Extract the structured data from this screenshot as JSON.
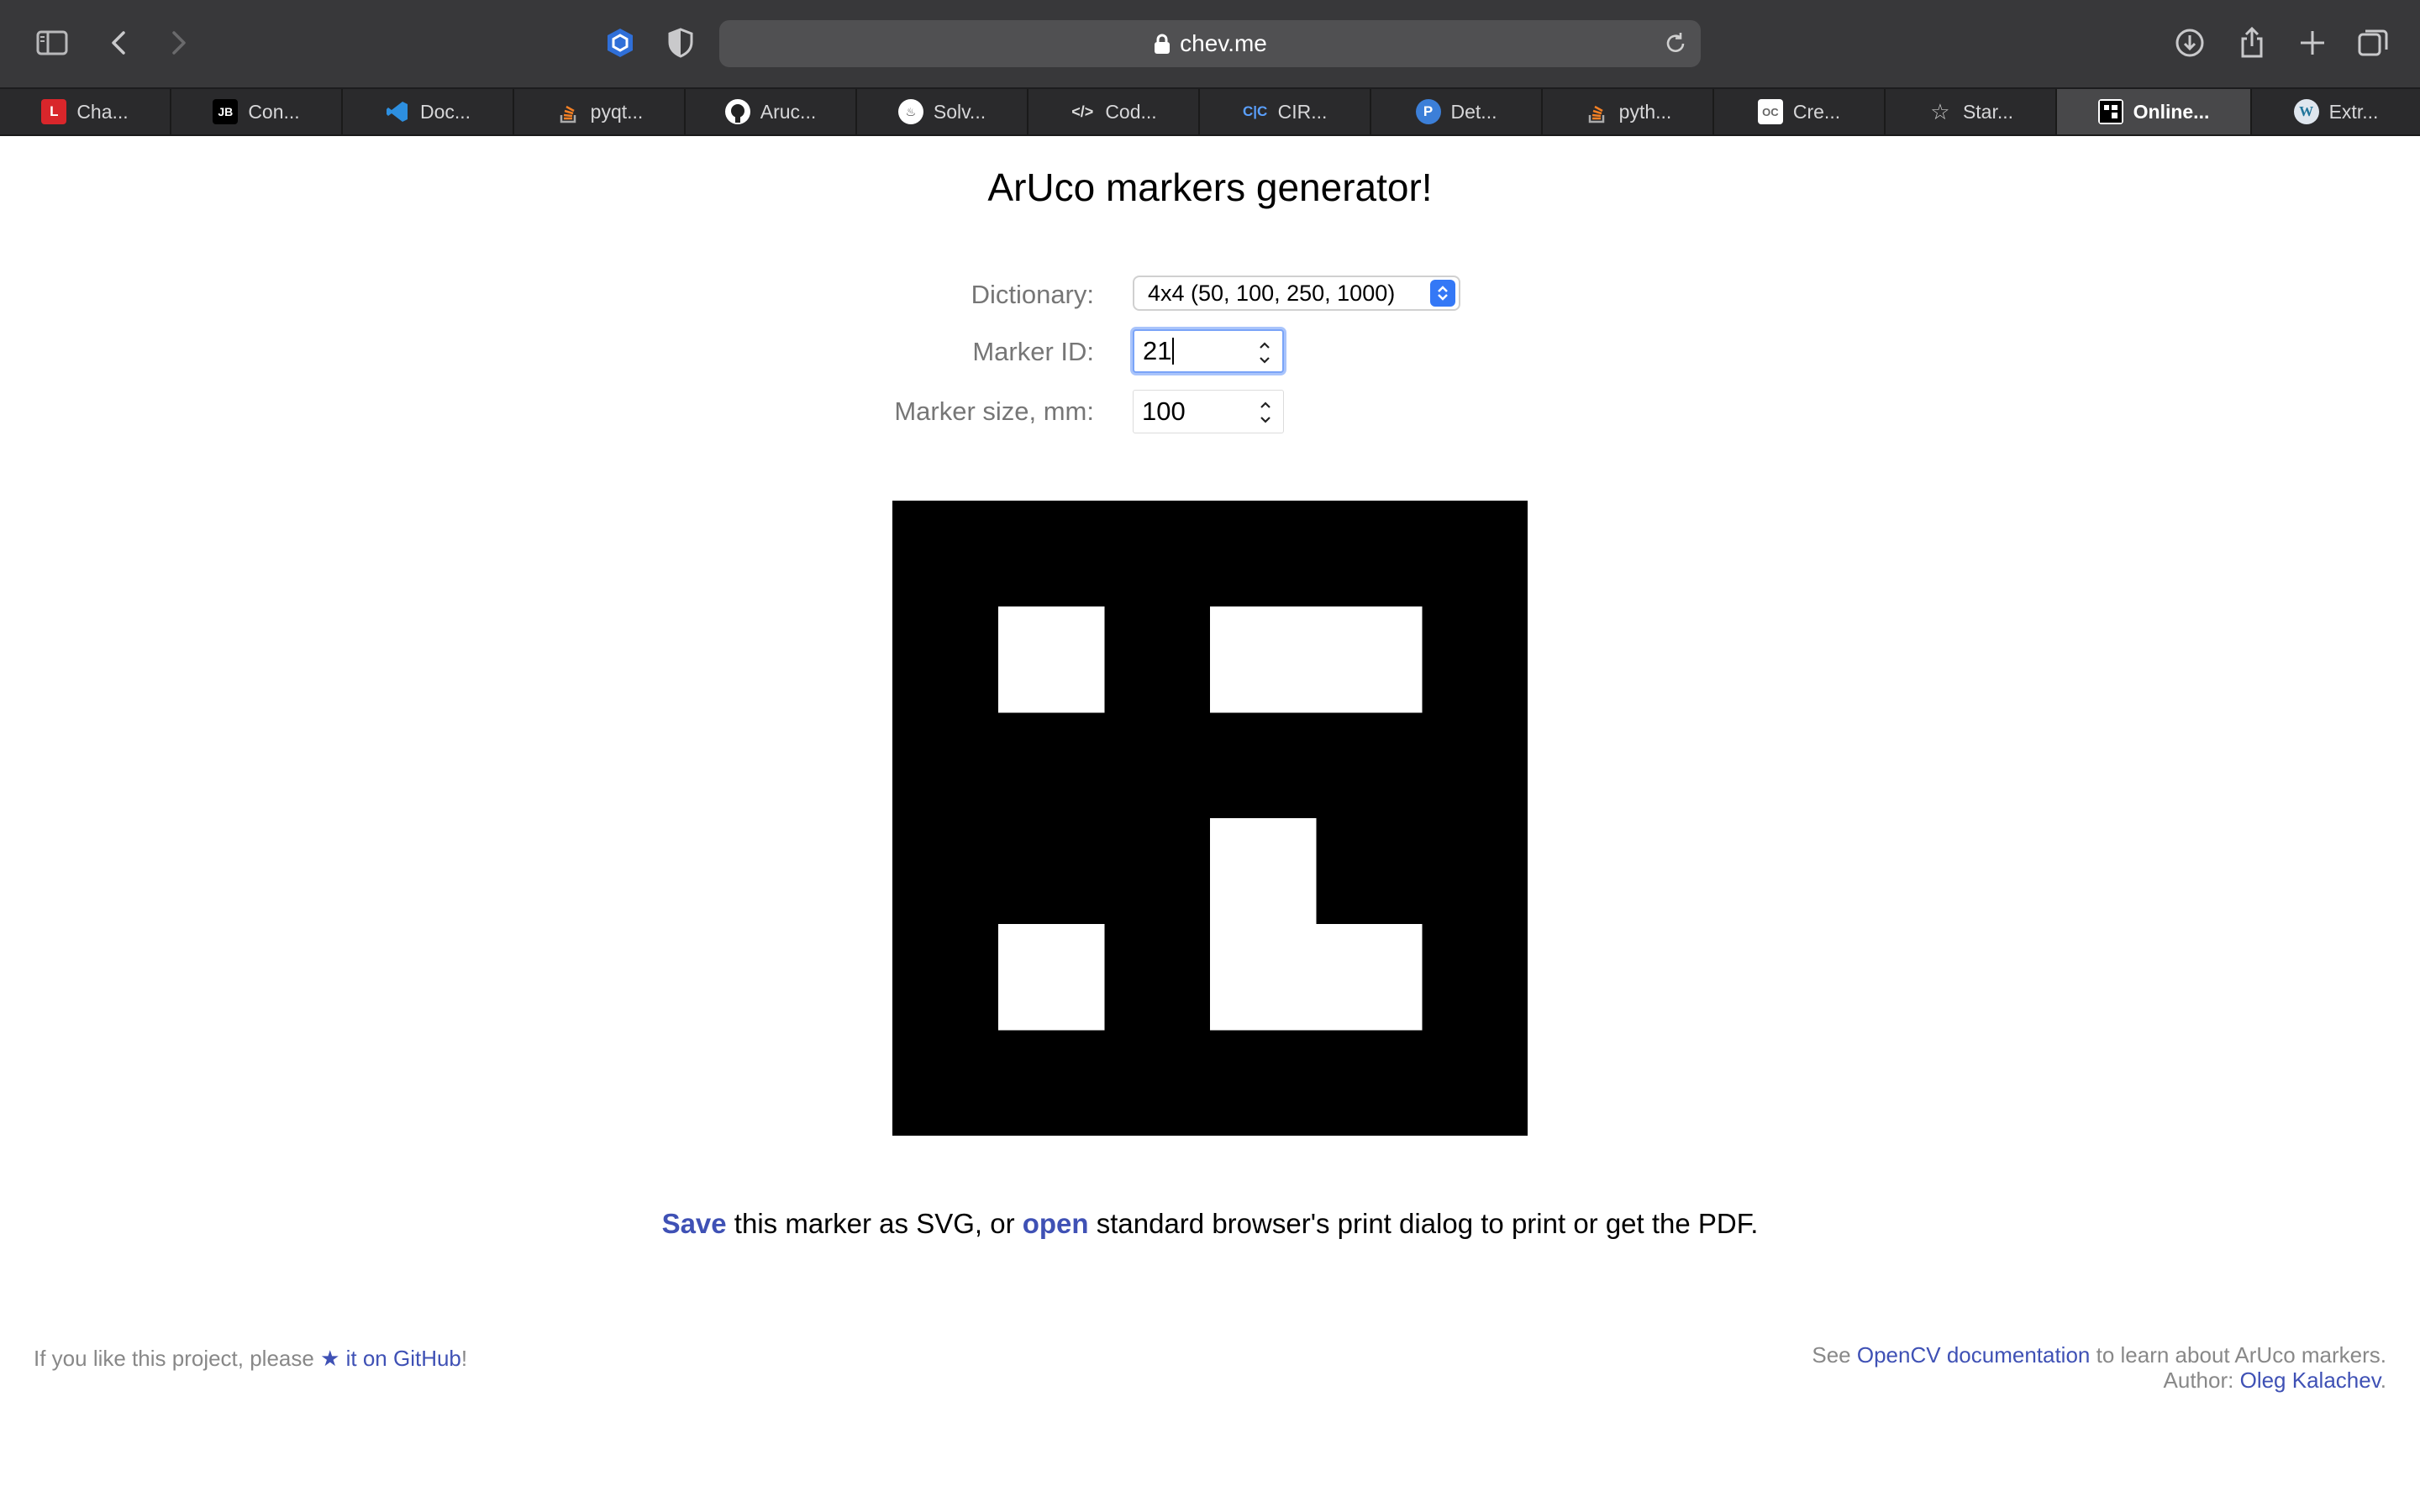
{
  "browser": {
    "url": "chev.me",
    "tabs": [
      {
        "label": "Cha...",
        "favicon": "red-logo-icon",
        "active": false
      },
      {
        "label": "Con...",
        "favicon": "jetbrains-icon",
        "active": false
      },
      {
        "label": "Doc...",
        "favicon": "vscode-icon",
        "active": false
      },
      {
        "label": "pyqt...",
        "favicon": "stackoverflow-icon",
        "active": false
      },
      {
        "label": "Aruc...",
        "favicon": "github-icon",
        "active": false
      },
      {
        "label": "Solv...",
        "favicon": "circle-logo-icon",
        "active": false
      },
      {
        "label": "Cod...",
        "favicon": "code-icon",
        "active": false
      },
      {
        "label": "CIR...",
        "favicon": "cir-logo-icon",
        "active": false
      },
      {
        "label": "Det...",
        "favicon": "blue-p-icon",
        "active": false
      },
      {
        "label": "pyth...",
        "favicon": "stackoverflow-icon",
        "active": false
      },
      {
        "label": "Cre...",
        "favicon": "cv-logo-icon",
        "active": false
      },
      {
        "label": "Star...",
        "favicon": "star-icon",
        "active": false
      },
      {
        "label": "Online...",
        "favicon": "aruco-icon",
        "active": true
      },
      {
        "label": "Extr...",
        "favicon": "wordpress-icon",
        "active": false
      }
    ]
  },
  "page": {
    "title": "ArUco markers generator!",
    "form": {
      "dictionary_label": "Dictionary:",
      "dictionary_value": "4x4 (50, 100, 250, 1000)",
      "marker_id_label": "Marker ID:",
      "marker_id_value": "21",
      "marker_size_label": "Marker size, mm:",
      "marker_size_value": "100"
    },
    "marker": {
      "grid": [
        [
          1,
          0,
          1,
          1
        ],
        [
          0,
          0,
          0,
          0
        ],
        [
          0,
          0,
          1,
          0
        ],
        [
          1,
          0,
          1,
          1
        ]
      ],
      "colors": {
        "background": "#000000",
        "cell": "#ffffff"
      }
    },
    "save_line": {
      "save_link": "Save",
      "text_1": " this marker as SVG, or ",
      "open_link": "open",
      "text_2": " standard browser's print dialog to print or get the PDF."
    },
    "footer": {
      "left_text_1": "If you like this project, please ",
      "star_glyph": "★",
      "github_link": " it on GitHub",
      "left_text_2": "!",
      "right_see": "See ",
      "opencv_link": "OpenCV documentation",
      "right_learn": " to learn about ArUco markers.",
      "author_label": "Author: ",
      "author_link": "Oleg Kalachev",
      "author_end": "."
    },
    "colors": {
      "link": "#3f51b5",
      "muted": "#888888"
    }
  }
}
